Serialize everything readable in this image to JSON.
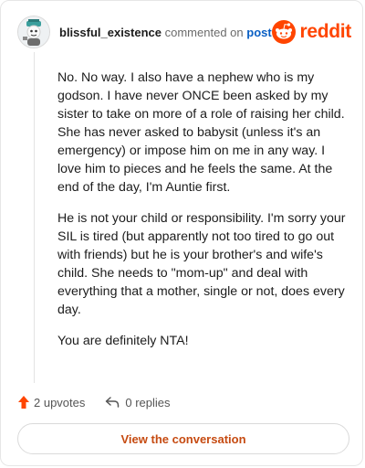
{
  "header": {
    "username": "blissful_existence",
    "action_text": "commented on",
    "post_link": "post",
    "brand": "reddit"
  },
  "comment": {
    "paragraphs": [
      "No. No way. I also have a nephew who is my godson. I have never ONCE been asked by my sister to take on more of a role of raising her child. She has never asked to babysit (unless it's an emergency) or impose him on me in any way. I love him to pieces and he feels the same. At the end of the day, I'm Auntie first.",
      "He is not your child or responsibility. I'm sorry your SIL is tired (but apparently not too tired to go out with friends) but he is your brother's and wife's child. She needs to \"mom-up\" and deal with everything that a mother, single or not, does every day.",
      "You are definitely NTA!"
    ]
  },
  "footer": {
    "upvotes": "2 upvotes",
    "replies": "0 replies"
  },
  "cta": {
    "label": "View the conversation"
  },
  "colors": {
    "brand": "#ff4500",
    "link": "#0a5fc4",
    "cta_text": "#c64b12"
  },
  "icons": [
    "avatar",
    "reddit-logo-icon",
    "upvote-arrow-icon",
    "reply-arrow-icon"
  ]
}
